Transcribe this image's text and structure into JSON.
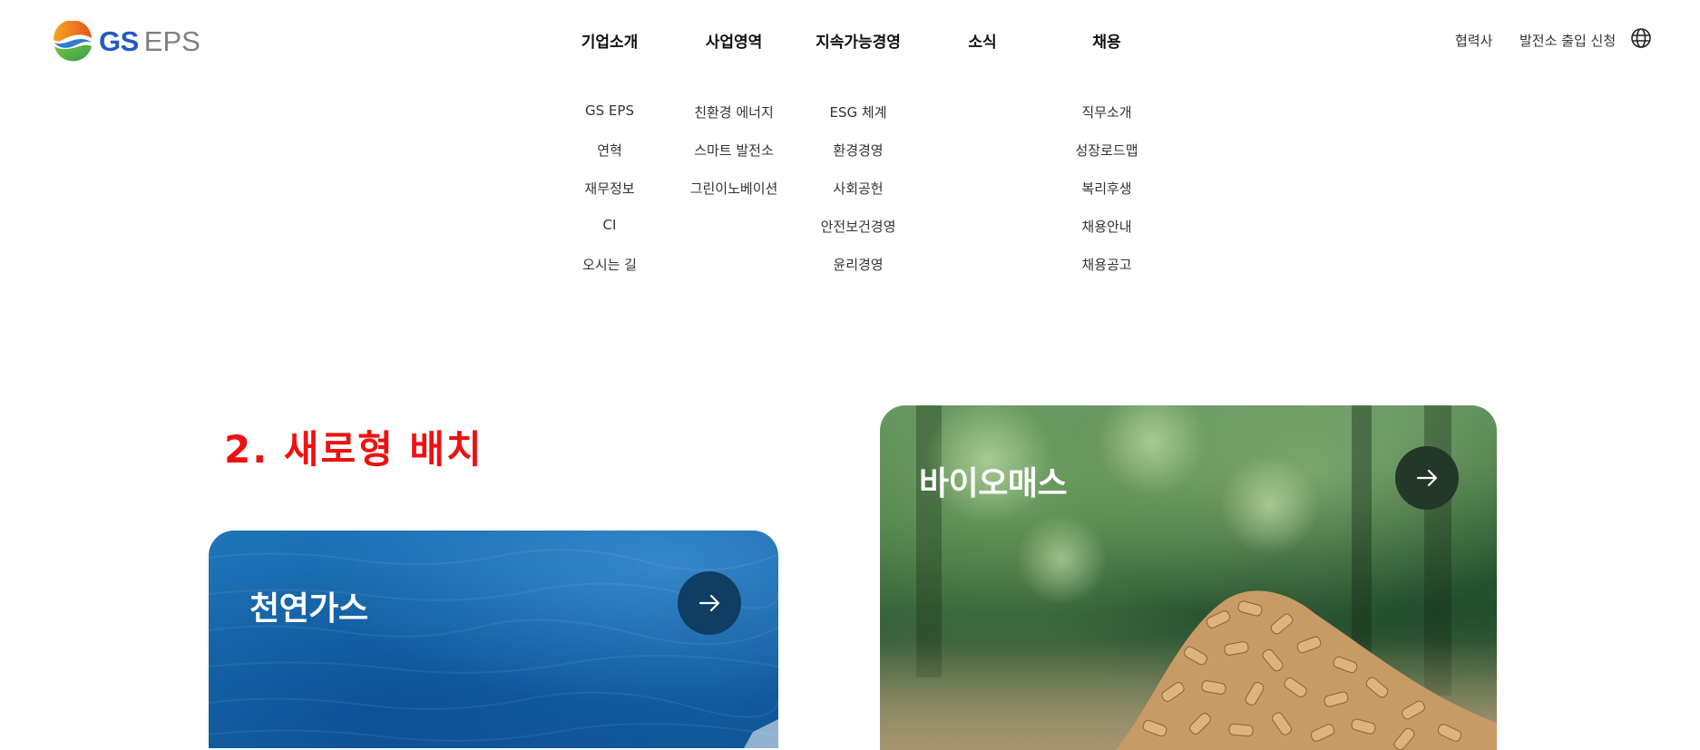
{
  "header": {
    "logo": {
      "brand": "GS",
      "product": "EPS"
    },
    "nav": [
      {
        "label": "기업소개",
        "items": [
          "GS EPS",
          "연혁",
          "재무정보",
          "CI",
          "오시는 길"
        ]
      },
      {
        "label": "사업영역",
        "items": [
          "친환경 에너지",
          "스마트 발전소",
          "그린이노베이션"
        ]
      },
      {
        "label": "지속가능경영",
        "items": [
          "ESG 체계",
          "환경경영",
          "사회공헌",
          "안전보건경영",
          "윤리경영"
        ]
      },
      {
        "label": "소식",
        "items": []
      },
      {
        "label": "채용",
        "items": [
          "직무소개",
          "성장로드맵",
          "복리후생",
          "채용안내",
          "채용공고"
        ]
      }
    ],
    "utility": {
      "partner": "협력사",
      "plant_access": "발전소 출입 신청",
      "language_icon": "globe-icon"
    }
  },
  "main": {
    "section_title": "2. 새로형 배치",
    "cards": [
      {
        "title": "천연가스",
        "button_icon": "arrow-right-icon"
      },
      {
        "title": "바이오매스",
        "button_icon": "arrow-right-icon"
      }
    ]
  },
  "colors": {
    "brand_blue": "#2458c5",
    "section_title_red": "#ee1111",
    "gas_card_blue": "#1566a8",
    "arrow_gas_bg": "#0f3d63",
    "arrow_bio_bg": "#24382a"
  }
}
